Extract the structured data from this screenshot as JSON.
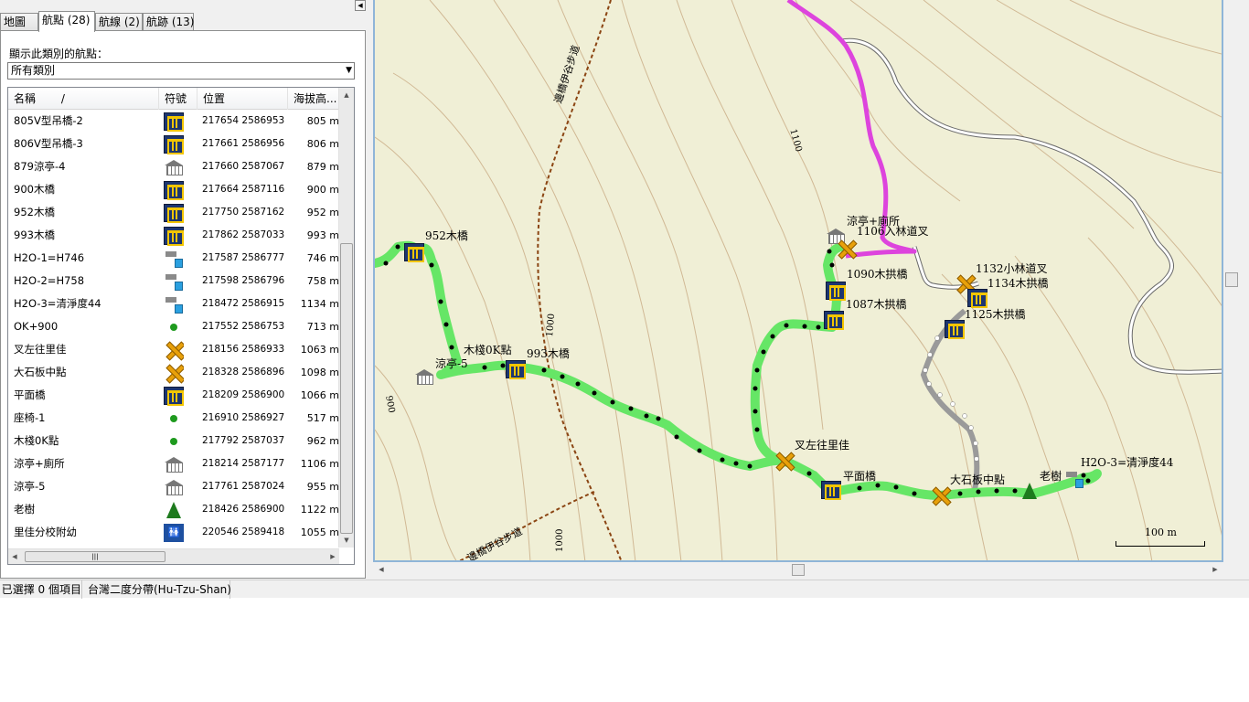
{
  "tabs": [
    {
      "label": "地圖"
    },
    {
      "label": "航點 (28)"
    },
    {
      "label": "航線 (2)"
    },
    {
      "label": "航跡 (13)"
    }
  ],
  "filter": {
    "label": "顯示此類別的航點：",
    "selected": "所有類別"
  },
  "list": {
    "columns": [
      "名稱",
      "符號",
      "位置",
      "海拔高..."
    ],
    "sort_indicator": "/",
    "rows": [
      {
        "name": "805V型吊橋-2",
        "symbol": "bridge-icon",
        "position": "217654 2586953",
        "altitude": "805 m"
      },
      {
        "name": "806V型吊橋-3",
        "symbol": "bridge-icon",
        "position": "217661 2586956",
        "altitude": "806 m"
      },
      {
        "name": "879涼亭-4",
        "symbol": "pavilion-icon",
        "position": "217660 2587067",
        "altitude": "879 m"
      },
      {
        "name": "900木橋",
        "symbol": "bridge-icon",
        "position": "217664 2587116",
        "altitude": "900 m"
      },
      {
        "name": "952木橋",
        "symbol": "bridge-icon",
        "position": "217750 2587162",
        "altitude": "952 m"
      },
      {
        "name": "993木橋",
        "symbol": "bridge-icon",
        "position": "217862 2587033",
        "altitude": "993 m"
      },
      {
        "name": "H2O-1=H746",
        "symbol": "water-icon",
        "position": "217587 2586777",
        "altitude": "746 m"
      },
      {
        "name": "H2O-2=H758",
        "symbol": "water-icon",
        "position": "217598 2586796",
        "altitude": "758 m"
      },
      {
        "name": "H2O-3=清淨度44",
        "symbol": "water-icon",
        "position": "218472 2586915",
        "altitude": "1134 m"
      },
      {
        "name": "OK+900",
        "symbol": "dot-icon",
        "position": "217552 2586753",
        "altitude": "713 m"
      },
      {
        "name": "叉左往里佳",
        "symbol": "crossroad-icon",
        "position": "218156 2586933",
        "altitude": "1063 m"
      },
      {
        "name": "大石板中點",
        "symbol": "crossroad-icon",
        "position": "218328 2586896",
        "altitude": "1098 m"
      },
      {
        "name": "平面橋",
        "symbol": "bridge-icon",
        "position": "218209 2586900",
        "altitude": "1066 m"
      },
      {
        "name": "座椅-1",
        "symbol": "dot-icon",
        "position": "216910 2586927",
        "altitude": "517 m"
      },
      {
        "name": "木棧0K點",
        "symbol": "dot-icon",
        "position": "217792 2587037",
        "altitude": "962 m"
      },
      {
        "name": "涼亭+廁所",
        "symbol": "pavilion-icon",
        "position": "218214 2587177",
        "altitude": "1106 m"
      },
      {
        "name": "涼亭-5",
        "symbol": "pavilion-icon",
        "position": "217761 2587024",
        "altitude": "955 m"
      },
      {
        "name": "老樹",
        "symbol": "tree-icon",
        "position": "218426 2586900",
        "altitude": "1122 m"
      },
      {
        "name": "里佳分校附幼",
        "symbol": "toilet-icon",
        "position": "220546 2589418",
        "altitude": "1055 m"
      }
    ]
  },
  "map": {
    "labels": {
      "wp_952": "952木橋",
      "pavilion5": "涼亭-5",
      "ok0": "木棧0K點",
      "wp_993": "993木橋",
      "pav_toilet": "涼亭+廁所",
      "jct1106": "1106入林道叉",
      "b1090": "1090木拱橋",
      "b1087": "1087木拱橋",
      "j1132": "1132小林道叉",
      "b1134": "1134木拱橋",
      "b1125": "1125木拱橋",
      "fork": "叉左往里佳",
      "flat_bridge": "平面橋",
      "stone_mid": "大石板中點",
      "old_tree": "老樹",
      "h2o3": "H2O-3=清淨度44",
      "trail_top": "邊橋伊谷步道",
      "trail_bottom": "邊橋伊谷步道",
      "c1100": "1100",
      "c1000a": "1000",
      "c900": "900",
      "c1000b": "1000"
    },
    "scale": "100 m"
  },
  "status": {
    "selected": "已選擇 0 個項目",
    "datum": "台灣二度分帶(Hu-Tzu-Shan)"
  }
}
